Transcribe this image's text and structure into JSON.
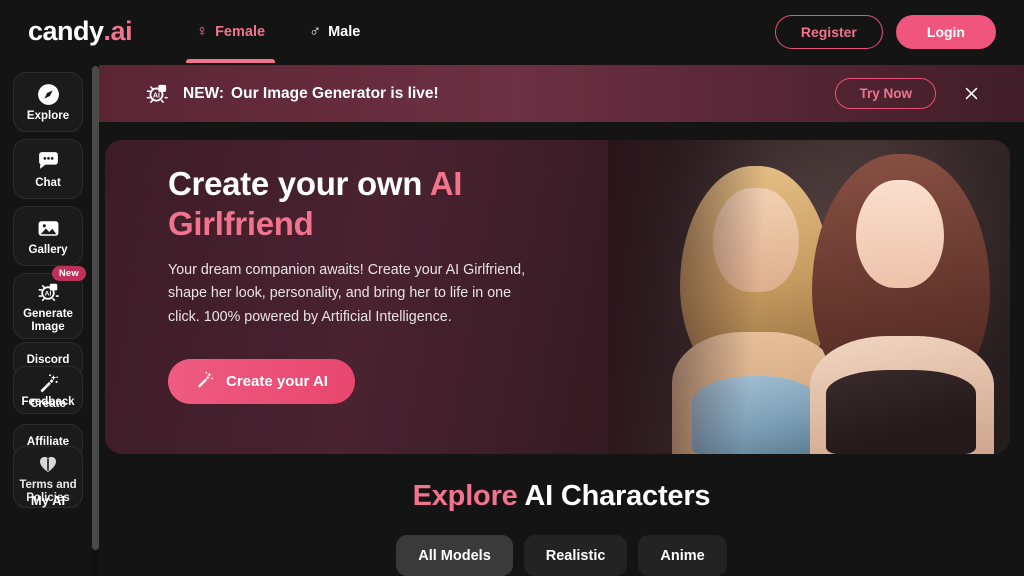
{
  "brand": {
    "name_white": "candy",
    "name_pink": ".ai"
  },
  "nav": {
    "items": [
      {
        "label": "Female",
        "icon": "female-gender-icon",
        "glyph": "♀",
        "active": true
      },
      {
        "label": "Male",
        "icon": "male-gender-icon",
        "glyph": "♂",
        "active": false
      }
    ]
  },
  "auth": {
    "register_label": "Register",
    "login_label": "Login"
  },
  "banner": {
    "icon": "ai-image-generator-icon",
    "lead": "NEW:",
    "message": "Our Image Generator is live!",
    "cta_label": "Try Now",
    "close_icon": "close-icon"
  },
  "sidebar": {
    "items": [
      {
        "label": "Explore",
        "icon": "compass-icon"
      },
      {
        "label": "Chat",
        "icon": "chat-bubble-icon"
      },
      {
        "label": "Gallery",
        "icon": "image-icon"
      },
      {
        "label": "Generate Image",
        "icon": "ai-image-generator-icon",
        "badge": "New"
      },
      {
        "label": "Discord",
        "icon": "discord-icon"
      },
      {
        "label": "Create",
        "icon": "magic-wand-icon"
      },
      {
        "label": "Feedback",
        "icon": "feedback-icon"
      },
      {
        "label": "Affiliate",
        "icon": "affiliate-icon"
      },
      {
        "label": "My AI",
        "icon": "heart-icon"
      },
      {
        "label": "Terms and Policies",
        "icon": "policy-icon"
      }
    ]
  },
  "hero": {
    "title_part1": "Create your own ",
    "title_part2": "AI Girlfriend",
    "paragraph": "Your dream companion awaits! Create your AI Girlfriend, shape her look, personality, and bring her to life in one click. 100% powered by Artificial Intelligence.",
    "cta_label": "Create your AI",
    "cta_icon": "magic-wand-icon"
  },
  "explore": {
    "heading_pink": "Explore",
    "heading_white": " AI Characters",
    "filters": [
      {
        "label": "All Models",
        "active": true
      },
      {
        "label": "Realistic",
        "active": false
      },
      {
        "label": "Anime",
        "active": false
      }
    ]
  },
  "colors": {
    "accent_pink": "#f2738d",
    "login_pink": "#f0557e",
    "badge_crimson": "#c0315a",
    "page_bg": "#141414",
    "card_bg": "#1b1b1b"
  }
}
